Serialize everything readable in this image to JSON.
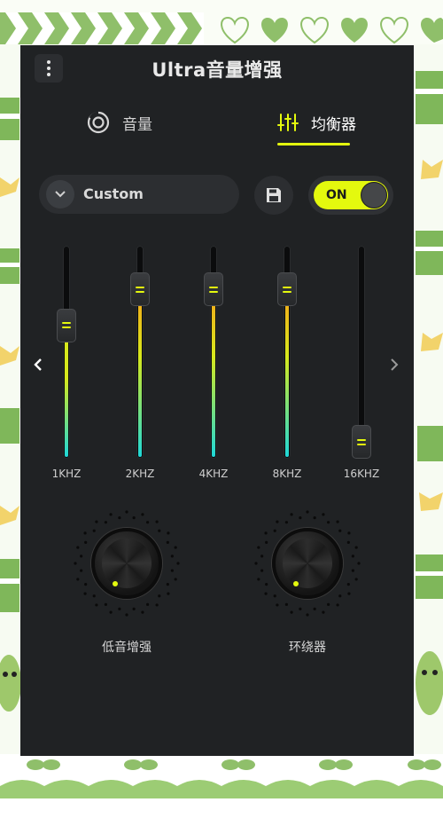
{
  "app": {
    "title": "Ultra音量增强"
  },
  "tabs": [
    {
      "label": "音量",
      "icon": "volume-ring-icon",
      "active": false
    },
    {
      "label": "均衡器",
      "icon": "sliders-icon",
      "active": true
    }
  ],
  "preset": {
    "selected": "Custom",
    "icon": "chevron-down-icon"
  },
  "save": {
    "icon": "save-icon"
  },
  "toggle": {
    "label": "ON",
    "state": true
  },
  "navigation": {
    "prev_icon": "chevron-left-icon",
    "next_icon": "chevron-right-icon"
  },
  "equalizer": {
    "bands": [
      {
        "label": "1KHZ",
        "level": 0.65
      },
      {
        "label": "2KHZ",
        "level": 0.85
      },
      {
        "label": "4KHZ",
        "level": 0.85
      },
      {
        "label": "8KHZ",
        "level": 0.85
      },
      {
        "label": "16KHZ",
        "level": 0.0
      }
    ]
  },
  "knobs": [
    {
      "label": "低音增强",
      "value": 0
    },
    {
      "label": "环绕器",
      "value": 0
    }
  ],
  "colors": {
    "accent": "#e4f90e",
    "dialog_bg": "#202224",
    "control_bg": "#2c2e31",
    "bar_gradient_top": "#f6a21a",
    "bar_gradient_mid": "#d7e81c",
    "bar_gradient_bottom": "#1fd8d8"
  }
}
